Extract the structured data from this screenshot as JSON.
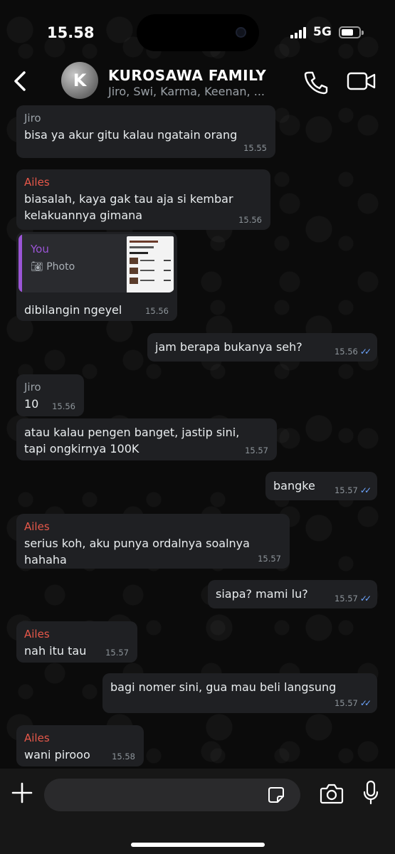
{
  "status_bar": {
    "time": "15.58",
    "network": "5G"
  },
  "header": {
    "avatar_letter": "K",
    "title": "KUROSAWA FAMILY",
    "subtitle": "Jiro, Swi, Karma, Keenan, ..."
  },
  "colors": {
    "bubble": "#1f2023",
    "sender_jiro": "#9aa0a6",
    "sender_ailes": "#e8584a",
    "reply_accent": "#9b55d6",
    "read_ticks": "#6ea6ff"
  },
  "messages": [
    {
      "direction": "incoming",
      "sender": "Jiro",
      "lines": [
        "bisa ya akur gitu kalau ngatain orang"
      ],
      "time": "15.55"
    },
    {
      "direction": "incoming",
      "sender": "Ailes",
      "lines": [
        "biasalah, kaya gak tau aja si kembar",
        "kelakuannya gimana"
      ],
      "time": "15.56"
    },
    {
      "direction": "incoming",
      "reply_to": {
        "name": "You",
        "type": "Photo"
      },
      "lines": [
        "dibilangin ngeyel"
      ],
      "time": "15.56"
    },
    {
      "direction": "outgoing",
      "lines": [
        "jam berapa bukanya seh?"
      ],
      "time": "15.56",
      "read": true
    },
    {
      "direction": "incoming",
      "sender": "Jiro",
      "lines": [
        "10"
      ],
      "time": "15.56"
    },
    {
      "direction": "incoming",
      "lines": [
        "atau kalau pengen banget, jastip sini,",
        "tapi ongkirnya 100K"
      ],
      "time": "15.57"
    },
    {
      "direction": "outgoing",
      "lines": [
        "bangke"
      ],
      "time": "15.57",
      "read": true
    },
    {
      "direction": "incoming",
      "sender": "Ailes",
      "lines": [
        "serius koh, aku punya ordalnya soalnya",
        "hahaha"
      ],
      "time": "15.57"
    },
    {
      "direction": "outgoing",
      "lines": [
        "siapa? mami lu?"
      ],
      "time": "15.57",
      "read": true
    },
    {
      "direction": "incoming",
      "sender": "Ailes",
      "lines": [
        "nah itu tau"
      ],
      "time": "15.57"
    },
    {
      "direction": "outgoing",
      "lines": [
        "bagi nomer sini, gua mau beli langsung"
      ],
      "time": "15.57",
      "read": true
    },
    {
      "direction": "incoming",
      "sender": "Ailes",
      "lines": [
        "wani pirooo"
      ],
      "time": "15.58"
    }
  ],
  "input": {
    "placeholder": ""
  },
  "icons": {
    "back": "chevron-left-icon",
    "call": "phone-icon",
    "video": "video-camera-icon",
    "plus": "plus-icon",
    "sticker": "sticker-icon",
    "camera": "camera-icon",
    "mic": "microphone-icon"
  }
}
